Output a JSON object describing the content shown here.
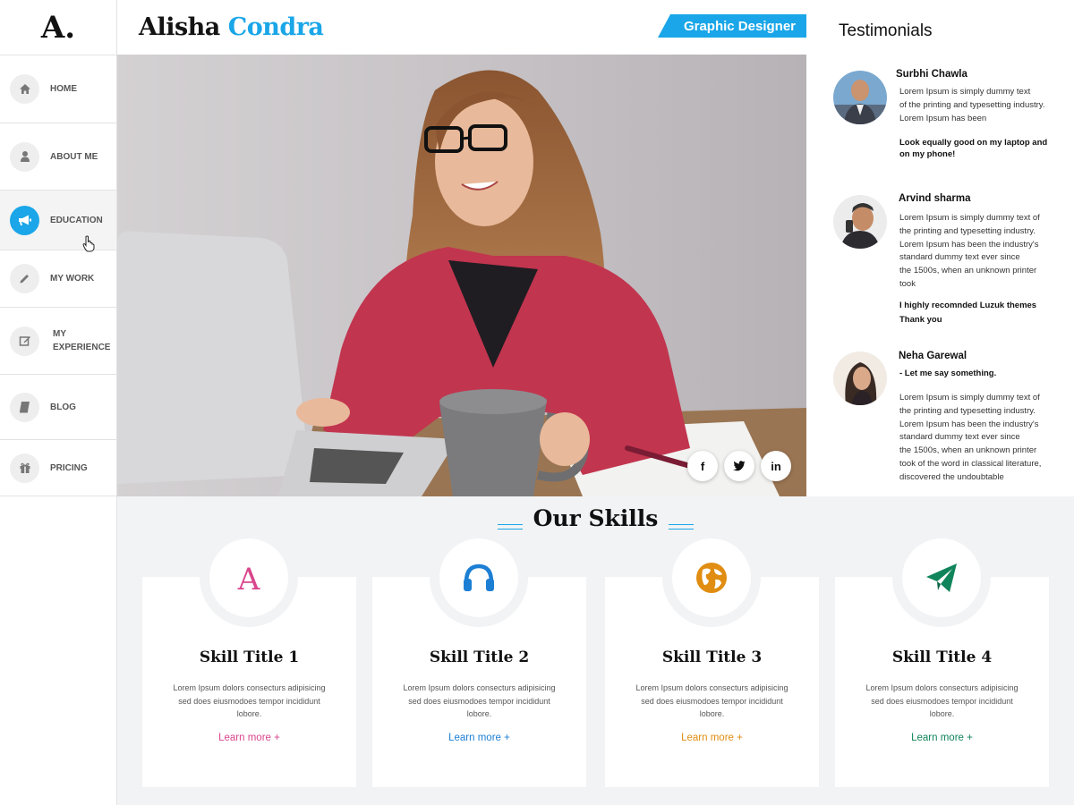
{
  "logo": "A.",
  "nav": [
    {
      "label": "HOME",
      "icon": "home-icon"
    },
    {
      "label": "ABOUT ME",
      "icon": "user-icon"
    },
    {
      "label": "EDUCATION",
      "icon": "megaphone-icon"
    },
    {
      "label": "MY WORK",
      "icon": "pencil-icon"
    },
    {
      "label": "MY",
      "label2": "EXPERIENCE",
      "icon": "edit-icon"
    },
    {
      "label": "BLOG",
      "icon": "book-icon"
    },
    {
      "label": "PRICING",
      "icon": "gift-icon"
    }
  ],
  "header": {
    "first_name": "Alisha",
    "last_name": "Condra",
    "role": "Graphic Designer"
  },
  "social": {
    "facebook": "f",
    "linkedin": "in"
  },
  "testimonials": {
    "title": "Testimonials",
    "items": [
      {
        "name": "Surbhi Chawla",
        "text": "Lorem Ipsum is simply dummy text\nof the printing and typesetting industry.\nLorem Ipsum has been",
        "quote": "Look equally good on my laptop and\non my phone!"
      },
      {
        "name": "Arvind sharma",
        "text": "Lorem Ipsum is simply dummy text of\nthe printing and typesetting industry.\nLorem Ipsum has been the industry's\nstandard dummy text ever since\nthe 1500s, when an unknown printer\n took",
        "quote": "I highly recomnded Luzuk themes\nThank you"
      },
      {
        "name": "Neha Garewal",
        "quote": "- Let me say something.",
        "text": "Lorem Ipsum is simply dummy text of\nthe printing and typesetting industry.\nLorem Ipsum has been the industry's\nstandard dummy text ever since\nthe 1500s, when an unknown printer\n took of the word in classical literature,\ndiscovered the undoubtable"
      }
    ]
  },
  "skills": {
    "title": "Our Skills",
    "cards": [
      {
        "title": "Skill Title 1",
        "desc": "Lorem Ipsum dolors consecturs adipisicing sed does eiusmodoes tempor incididunt lobore.",
        "link": "Learn more +",
        "icon": "letter-a-icon",
        "color": "#d9468c"
      },
      {
        "title": "Skill Title 2",
        "desc": "Lorem Ipsum dolors consecturs adipisicing sed does eiusmodoes tempor incididunt lobore.",
        "link": "Learn more +",
        "icon": "headphones-icon",
        "color": "#1c7fd4"
      },
      {
        "title": "Skill Title 3",
        "desc": "Lorem Ipsum dolors consecturs adipisicing sed does eiusmodoes tempor incididunt lobore.",
        "link": "Learn more +",
        "icon": "globe-icon",
        "color": "#e08d12"
      },
      {
        "title": "Skill Title 4",
        "desc": "Lorem Ipsum dolors consecturs adipisicing sed does eiusmodoes tempor incididunt lobore.",
        "link": "Learn more +",
        "icon": "paper-plane-icon",
        "color": "#10845a"
      }
    ]
  },
  "colors": {
    "accent": "#1aa6e8"
  }
}
